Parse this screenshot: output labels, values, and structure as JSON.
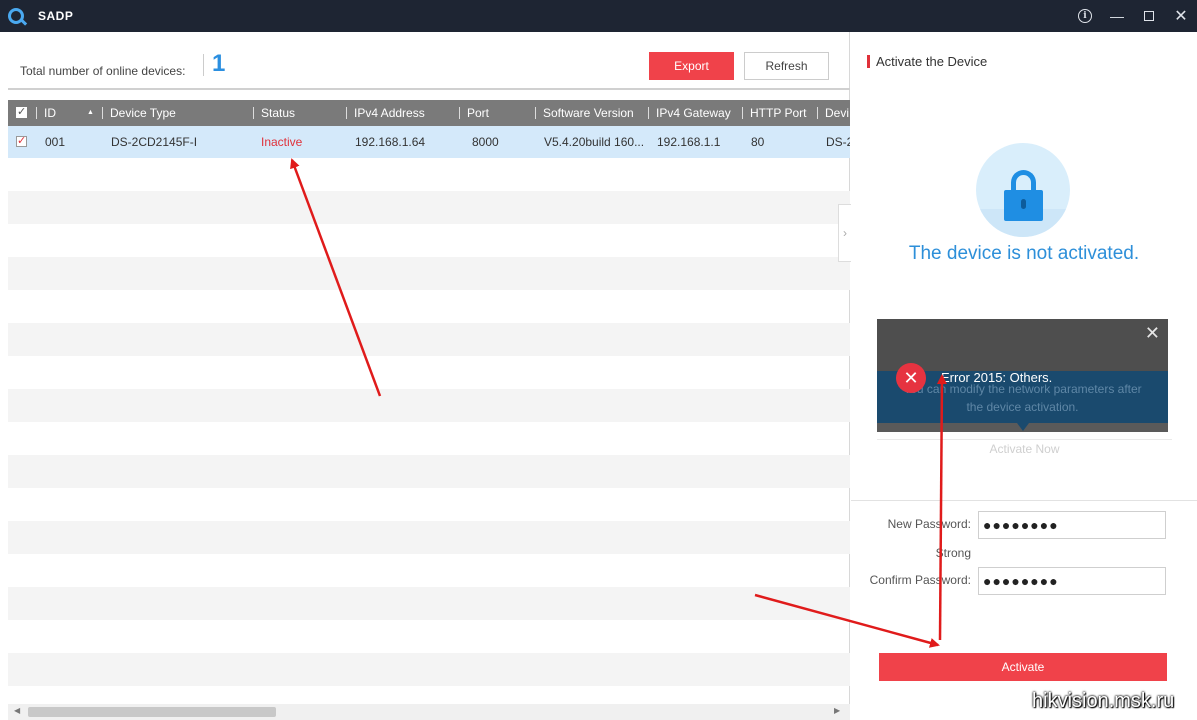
{
  "app": {
    "title": "SADP"
  },
  "toolbar": {
    "total_label": "Total number of online devices:",
    "total_count": "1",
    "export_label": "Export",
    "refresh_label": "Refresh"
  },
  "table": {
    "columns": [
      "ID",
      "Device Type",
      "Status",
      "IPv4 Address",
      "Port",
      "Software Version",
      "IPv4 Gateway",
      "HTTP Port",
      "Devi"
    ],
    "rows": [
      {
        "id": "001",
        "device_type": "DS-2CD2145F-I",
        "status": "Inactive",
        "ipv4": "192.168.1.64",
        "port": "8000",
        "software": "V5.4.20build 160...",
        "gateway": "192.168.1.1",
        "http_port": "80",
        "device": "DS-2"
      }
    ]
  },
  "panel": {
    "title": "Activate the Device",
    "message": "The device is not activated.",
    "error": {
      "text": "Error 2015: Others.",
      "hint_line1": "You can modify the network parameters after",
      "hint_line2": "the device activation."
    },
    "activate_now": "Activate Now",
    "new_password_label": "New Password:",
    "new_password_value": "●●●●●●●●",
    "strength_label": "Strong",
    "confirm_password_label": "Confirm Password:",
    "confirm_password_value": "●●●●●●●●",
    "activate_label": "Activate"
  },
  "watermark": "hikvision.msk.ru",
  "colors": {
    "accent_red": "#f0424a",
    "title_bar": "#1e2533",
    "count_blue": "#2b8fe0",
    "arrow_red": "#e01b1b"
  }
}
